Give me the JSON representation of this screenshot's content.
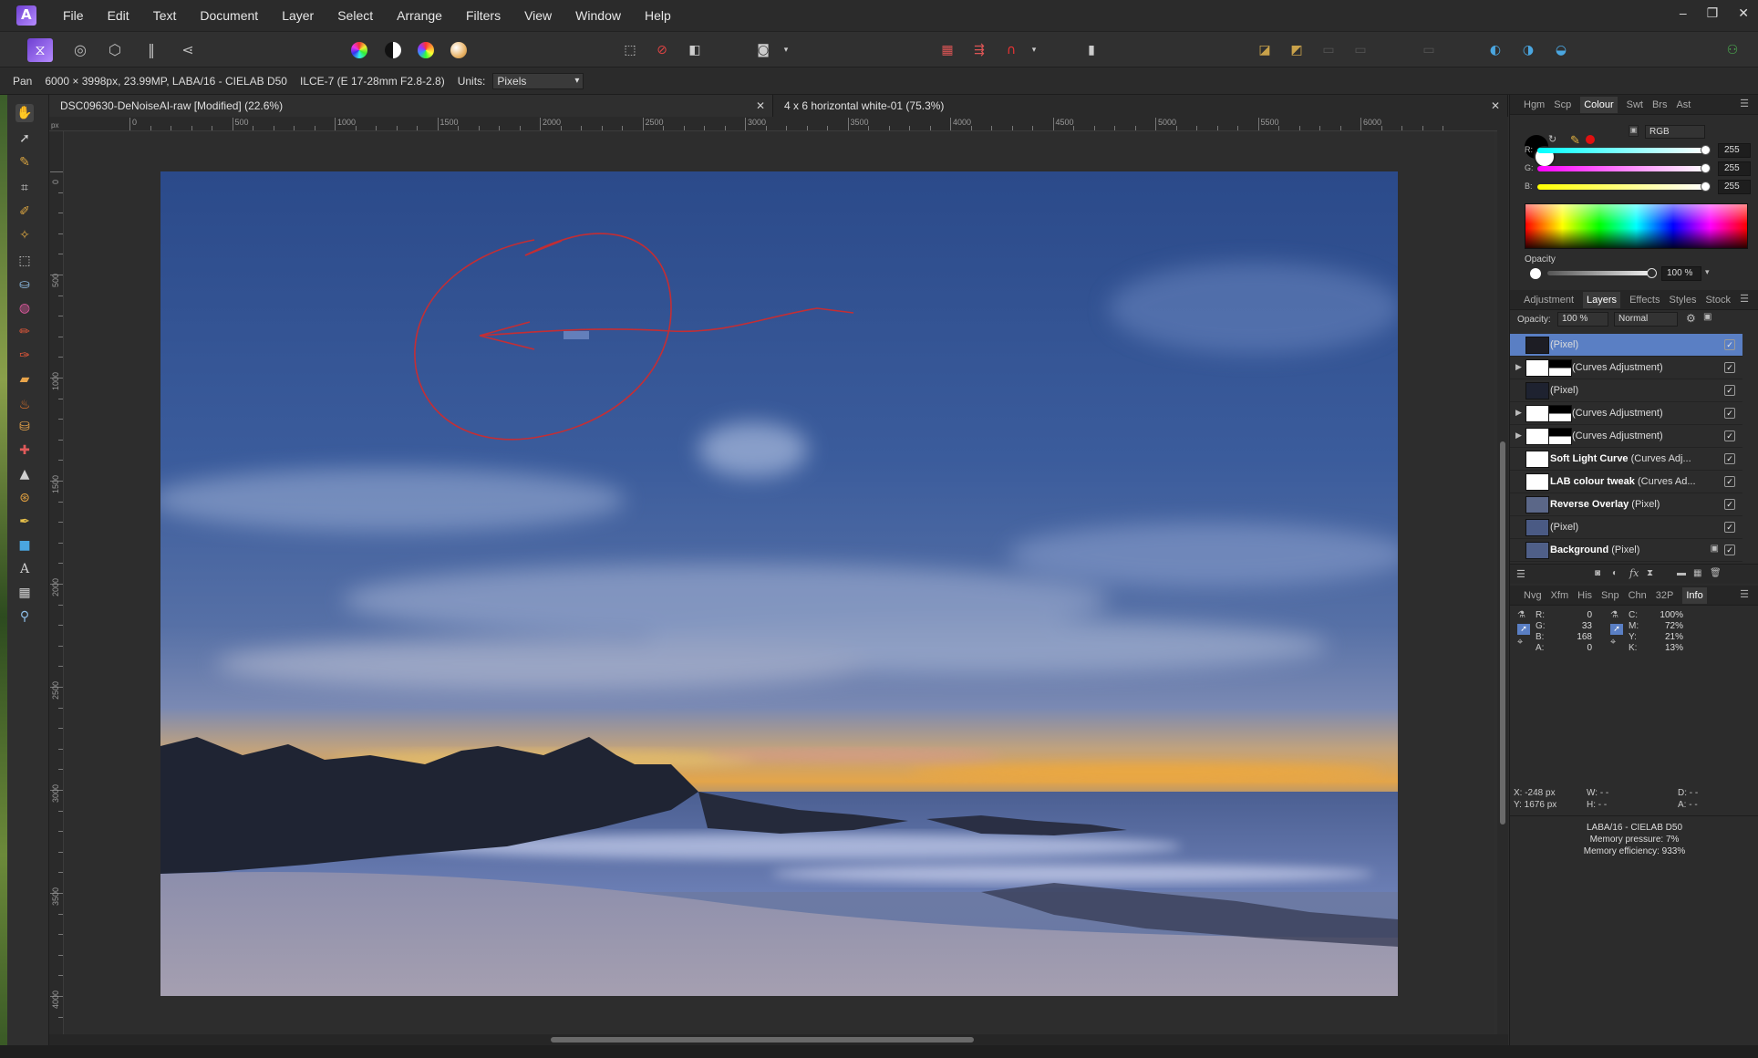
{
  "menu": [
    "File",
    "Edit",
    "Text",
    "Document",
    "Layer",
    "Select",
    "Arrange",
    "Filters",
    "View",
    "Window",
    "Help"
  ],
  "window_controls": {
    "minimize": "–",
    "restore": "❐",
    "close": "✕"
  },
  "context_bar": {
    "tool": "Pan",
    "doc_info": "6000 × 3998px, 23.99MP, LABA/16 - CIELAB D50",
    "camera": "ILCE-7 (E 17-28mm F2.8-2.8)",
    "units_label": "Units:",
    "units_value": "Pixels"
  },
  "tabs": [
    {
      "title": "DSC09630-DeNoiseAI-raw [Modified] (22.6%)",
      "close": "✕"
    },
    {
      "title": "4 x 6 horizontal white-01 (75.3%)",
      "close": "✕"
    }
  ],
  "rulers": {
    "unit": "px",
    "h_labels": [
      "0",
      "500",
      "1000",
      "1500",
      "2000",
      "2500",
      "3000",
      "3500",
      "4000",
      "4500",
      "5000",
      "5500",
      "6000"
    ],
    "v_labels": [
      "0",
      "500",
      "1000",
      "1500",
      "2000",
      "2500",
      "3000",
      "3500",
      "4000"
    ]
  },
  "colour_panel": {
    "tabs": [
      "Hgm",
      "Scp",
      "Colour",
      "Swt",
      "Brs",
      "Ast"
    ],
    "active_tab": "Colour",
    "model": "RGB",
    "channels": [
      {
        "label": "R:",
        "value": "255",
        "color": "#e23b3b"
      },
      {
        "label": "G:",
        "value": "255",
        "color": "#e040e0"
      },
      {
        "label": "B:",
        "value": "255",
        "color": "#e0e020"
      }
    ],
    "opacity_label": "Opacity",
    "opacity_value": "100 %"
  },
  "layers_panel": {
    "tabs": [
      "Adjustment",
      "Layers",
      "Effects",
      "Styles",
      "Stock"
    ],
    "active_tab": "Layers",
    "opacity_label": "Opacity:",
    "opacity_value": "100 %",
    "blend_mode": "Normal",
    "layers": [
      {
        "bold": "",
        "type": "(Pixel)",
        "expander": false,
        "selected": true,
        "locked": false
      },
      {
        "bold": "",
        "type": "(Curves Adjustment)",
        "expander": true,
        "selected": false,
        "locked": false
      },
      {
        "bold": "",
        "type": "(Pixel)",
        "expander": false,
        "selected": false,
        "locked": false
      },
      {
        "bold": "",
        "type": "(Curves Adjustment)",
        "expander": true,
        "selected": false,
        "locked": false
      },
      {
        "bold": "",
        "type": "(Curves Adjustment)",
        "expander": true,
        "selected": false,
        "locked": false
      },
      {
        "bold": "Soft Light Curve",
        "type": "(Curves Adj...",
        "expander": false,
        "selected": false,
        "locked": false
      },
      {
        "bold": "LAB colour tweak",
        "type": "(Curves Ad...",
        "expander": false,
        "selected": false,
        "locked": false
      },
      {
        "bold": "Reverse Overlay",
        "type": "(Pixel)",
        "expander": false,
        "selected": false,
        "locked": false
      },
      {
        "bold": "",
        "type": "(Pixel)",
        "expander": false,
        "selected": false,
        "locked": false
      },
      {
        "bold": "Background",
        "type": "(Pixel)",
        "expander": false,
        "selected": false,
        "locked": true
      }
    ]
  },
  "info_panel": {
    "tabs": [
      "Nvg",
      "Xfm",
      "His",
      "Snp",
      "Chn",
      "32P",
      "Info"
    ],
    "active_tab": "Info",
    "rgba": [
      {
        "label": "R:",
        "value": "0"
      },
      {
        "label": "G:",
        "value": "33"
      },
      {
        "label": "B:",
        "value": "168"
      },
      {
        "label": "A:",
        "value": "0"
      }
    ],
    "cmyk": [
      {
        "label": "C:",
        "value": "100%"
      },
      {
        "label": "M:",
        "value": "72%"
      },
      {
        "label": "Y:",
        "value": "21%"
      },
      {
        "label": "K:",
        "value": "13%"
      }
    ],
    "x": "X: -248 px",
    "y": "Y: 1676 px",
    "w": "W: - -",
    "h": "H: - -",
    "d": "D: - -",
    "a": "A: - -",
    "colour_space": "LABA/16 - CIELAB D50",
    "memory_pressure": "Memory pressure: 7%",
    "memory_efficiency": "Memory efficiency: 933%"
  },
  "colors": {
    "accent": "#5a7fc4",
    "brand": "#7b4fe0",
    "annotation": "#d42a2a"
  }
}
